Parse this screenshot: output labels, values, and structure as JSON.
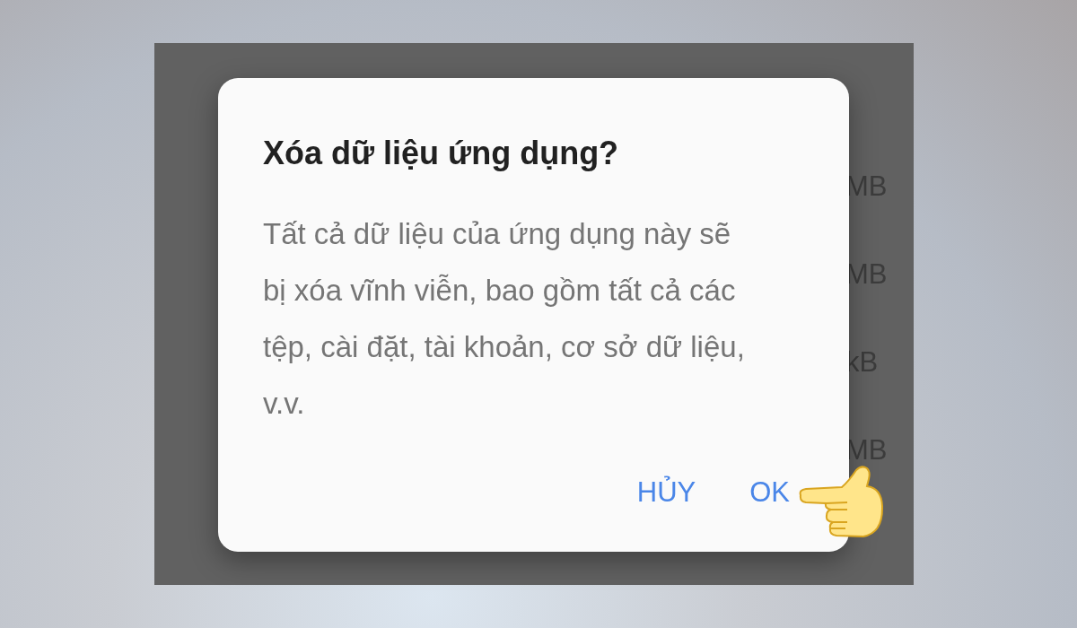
{
  "background_items": [
    {
      "size": "MB"
    },
    {
      "size": "MB"
    },
    {
      "size": "kB"
    },
    {
      "size": "MB"
    }
  ],
  "dialog": {
    "title": "Xóa dữ liệu ứng dụng?",
    "message": "Tất cả dữ liệu của ứng dụng này sẽ bị xóa vĩnh viễn, bao gồm tất cả các tệp, cài đặt, tài khoản, cơ sở dữ liệu, v.v.",
    "buttons": [
      "HỦY",
      "OK"
    ]
  }
}
